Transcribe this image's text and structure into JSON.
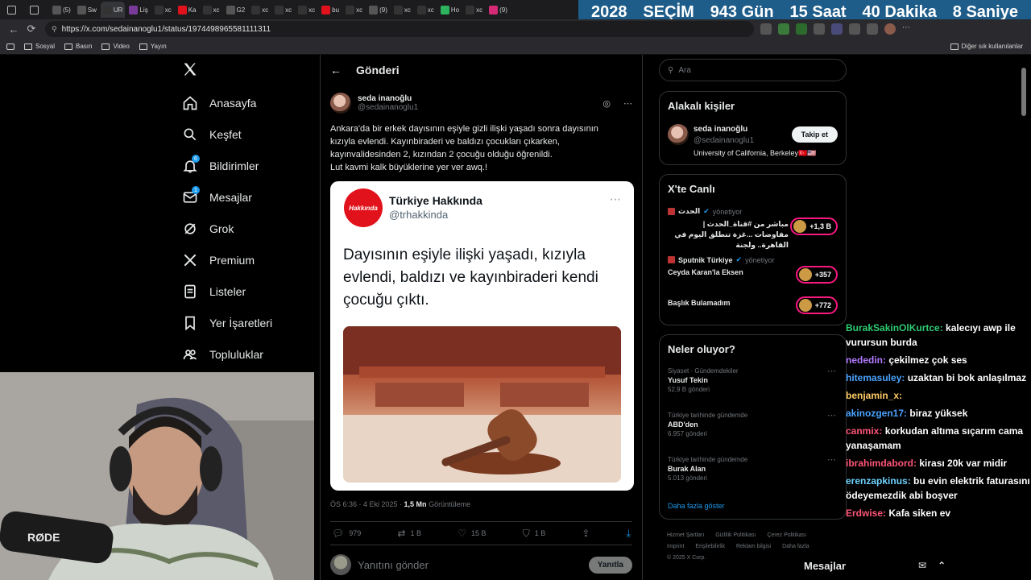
{
  "browser": {
    "tabs": [
      "(5)",
      "Sw",
      "UR",
      "Liş",
      "xc",
      "Ka",
      "xc",
      "G2",
      "xc",
      "xc",
      "xc",
      "bu",
      "xc",
      "(9)",
      "xc",
      "xc",
      "Ho",
      "xc",
      "(9)"
    ],
    "url": "https://x.com/sedainanoglu1/status/1974498965581111311",
    "bookmarks": [
      "Sosyal",
      "Basın",
      "Video",
      "Yayın"
    ],
    "other_bookmarks": "Diğer sık kullanılanlar"
  },
  "countdown": {
    "year": "2028",
    "label": "SEÇİM",
    "days": "943 Gün",
    "hours": "15 Saat",
    "minutes": "40 Dakika",
    "seconds": "8 Saniye"
  },
  "nav": {
    "items": [
      {
        "label": "Anasayfa",
        "icon": "home-icon"
      },
      {
        "label": "Keşfet",
        "icon": "search-icon"
      },
      {
        "label": "Bildirimler",
        "icon": "bell-icon",
        "badge": "6"
      },
      {
        "label": "Mesajlar",
        "icon": "mail-icon",
        "badge": "1"
      },
      {
        "label": "Grok",
        "icon": "grok-icon"
      },
      {
        "label": "Premium",
        "icon": "x-logo-icon"
      },
      {
        "label": "Listeler",
        "icon": "list-icon"
      },
      {
        "label": "Yer İşaretleri",
        "icon": "bookmark-icon"
      },
      {
        "label": "Topluluklar",
        "icon": "communities-icon"
      }
    ]
  },
  "header": {
    "title": "Gönderi"
  },
  "tweet": {
    "author_name": "seda inanoğlu",
    "author_handle": "@sedainanoglu1",
    "text_lines": [
      "Ankara'da bir erkek dayısının eşiyle gizli ilişki yaşadı sonra dayısının",
      "kızıyla evlendi. Kayınbiraderi ve baldızı çocukları çıkarken,",
      "kayınvalidesinden 2, kızından 2 çocuğu olduğu öğrenildi.",
      "Lut kavmi kalk büyüklerine yer ver awq.!"
    ],
    "embed": {
      "logo_text": "Hakkında",
      "name": "Türkiye Hakkında",
      "handle": "@trhakkinda",
      "text": "Dayısının eşiyle ilişki yaşadı, kızıyla evlendi, baldızı ve kayınbiraderi kendi çocuğu çıktı."
    },
    "time": "ÖS 6:36 · 4 Eki 2025 · ",
    "views": "1,5 Mn",
    "views_label": " Görüntüleme",
    "replies": "979",
    "retweets": "1 B",
    "likes": "15 B",
    "bookmarks": "1 B"
  },
  "reply": {
    "placeholder": "Yanıtını gönder",
    "button": "Yanıtla"
  },
  "search": {
    "placeholder": "Ara"
  },
  "related": {
    "title": "Alakalı kişiler",
    "name": "seda inanoğlu",
    "handle": "@sedainanoglu1",
    "bio": "University of California, Berkeley🇹🇷🇺🇸",
    "follow": "Takip et"
  },
  "live": {
    "title": "X'te Canlı",
    "items": [
      {
        "host": "الحدث",
        "role": "yönetiyor",
        "title": "مباشر من #قناة_الحدث | مفاوضات ...غزة تنطلق اليوم في القاهرة.. ولجنة",
        "count": "+1,3 B"
      },
      {
        "host": "Sputnik Türkiye",
        "role": "yönetiyor",
        "title": "Ceyda Karan'la Eksen",
        "count": "+357"
      },
      {
        "host": "",
        "role": "",
        "title": "Başlık Bulamadım",
        "count": "+772"
      }
    ]
  },
  "trends": {
    "title": "Neler oluyor?",
    "items": [
      {
        "context": "Siyaset · Gündemdekiler",
        "name": "Yusuf Tekin",
        "count": "52,9 B gönderi"
      },
      {
        "context": "Türkiye tarihinde gündemde",
        "name": "ABD'den",
        "count": "6.957 gönderi"
      },
      {
        "context": "Türkiye tarihinde gündemde",
        "name": "Burak Alan",
        "count": "5.013 gönderi"
      }
    ],
    "more": "Daha fazla göster"
  },
  "footer": {
    "links": [
      "Hizmet Şartları",
      "Gizlilik Politikası",
      "Çerez Politikası",
      "Imprint",
      "Erişilebilirlik",
      "Reklam bilgisi",
      "Daha fazla"
    ],
    "copyright": "© 2025 X Corp."
  },
  "chat": [
    {
      "user": "BurakSakinOlKurtce:",
      "text": " kalecıyı awp ile vurursun burda",
      "color": "#2ecc71"
    },
    {
      "user": "nededin:",
      "text": " çekilmez çok ses",
      "color": "#b27bff"
    },
    {
      "user": "hitemasuley:",
      "text": " uzaktan bi bok anlaşılmaz",
      "color": "#4aa3ff"
    },
    {
      "user": "benjamin_x:",
      "text": "",
      "color": "#ffcc66"
    },
    {
      "user": "akinozgen17:",
      "text": " biraz yüksek",
      "color": "#4aa3ff"
    },
    {
      "user": "canmix:",
      "text": " korkudan altıma sıçarım cama yanaşamam",
      "color": "#ff5577"
    },
    {
      "user": "ibrahimdabord:",
      "text": " kirası 20k var midir",
      "color": "#ff5577"
    },
    {
      "user": "erenzapkinus:",
      "text": " bu evin elektrik faturasını ödeyemezdik abi boşver",
      "color": "#6fd3ff"
    },
    {
      "user": "Erdwise:",
      "text": " Kafa siken ev",
      "color": "#ff5577"
    }
  ],
  "dock": {
    "label": "Mesajlar"
  },
  "colors": {
    "accent": "#1d9bf0",
    "live_ring": "#f91880"
  }
}
